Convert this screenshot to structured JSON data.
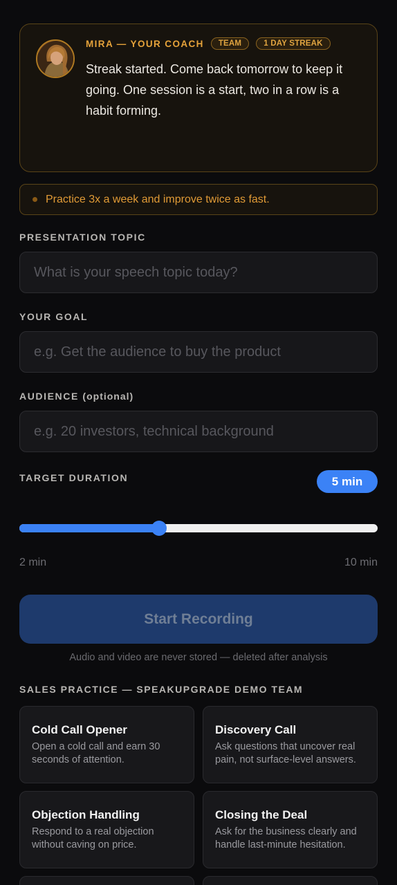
{
  "coach": {
    "name": "MIRA — YOUR COACH",
    "badges": [
      "TEAM",
      "1 DAY STREAK"
    ],
    "message": "Streak started. Come back tomorrow to keep it going. One session is a start, two in a row is a habit forming."
  },
  "tip": "Practice 3x a week and improve twice as fast.",
  "form": {
    "topic_label": "PRESENTATION TOPIC",
    "topic_placeholder": "What is your speech topic today?",
    "goal_label": "YOUR GOAL",
    "goal_placeholder": "e.g. Get the audience to buy the product",
    "audience_label": "AUDIENCE",
    "audience_optional": "(optional)",
    "audience_placeholder": "e.g. 20 investors, technical background",
    "duration_label": "TARGET DURATION",
    "duration_value": "5 min",
    "duration_min": "2 min",
    "duration_max": "10 min",
    "duration_fraction": 0.39
  },
  "start_button": "Start Recording",
  "privacy_note": "Audio and video are never stored — deleted after analysis",
  "scenarios_title": "SALES PRACTICE — SPEAKUPGRADE DEMO TEAM",
  "scenarios": [
    {
      "title": "Cold Call Opener",
      "desc": "Open a cold call and earn 30 seconds of attention."
    },
    {
      "title": "Discovery Call",
      "desc": "Ask questions that uncover real pain, not surface-level answers."
    },
    {
      "title": "Objection Handling",
      "desc": "Respond to a real objection without caving on price."
    },
    {
      "title": "Closing the Deal",
      "desc": "Ask for the business clearly and handle last-minute hesitation."
    }
  ],
  "colors": {
    "accent_blue": "#3b82f6",
    "coach_gold": "#e5a23a",
    "background": "#0b0b0d"
  }
}
